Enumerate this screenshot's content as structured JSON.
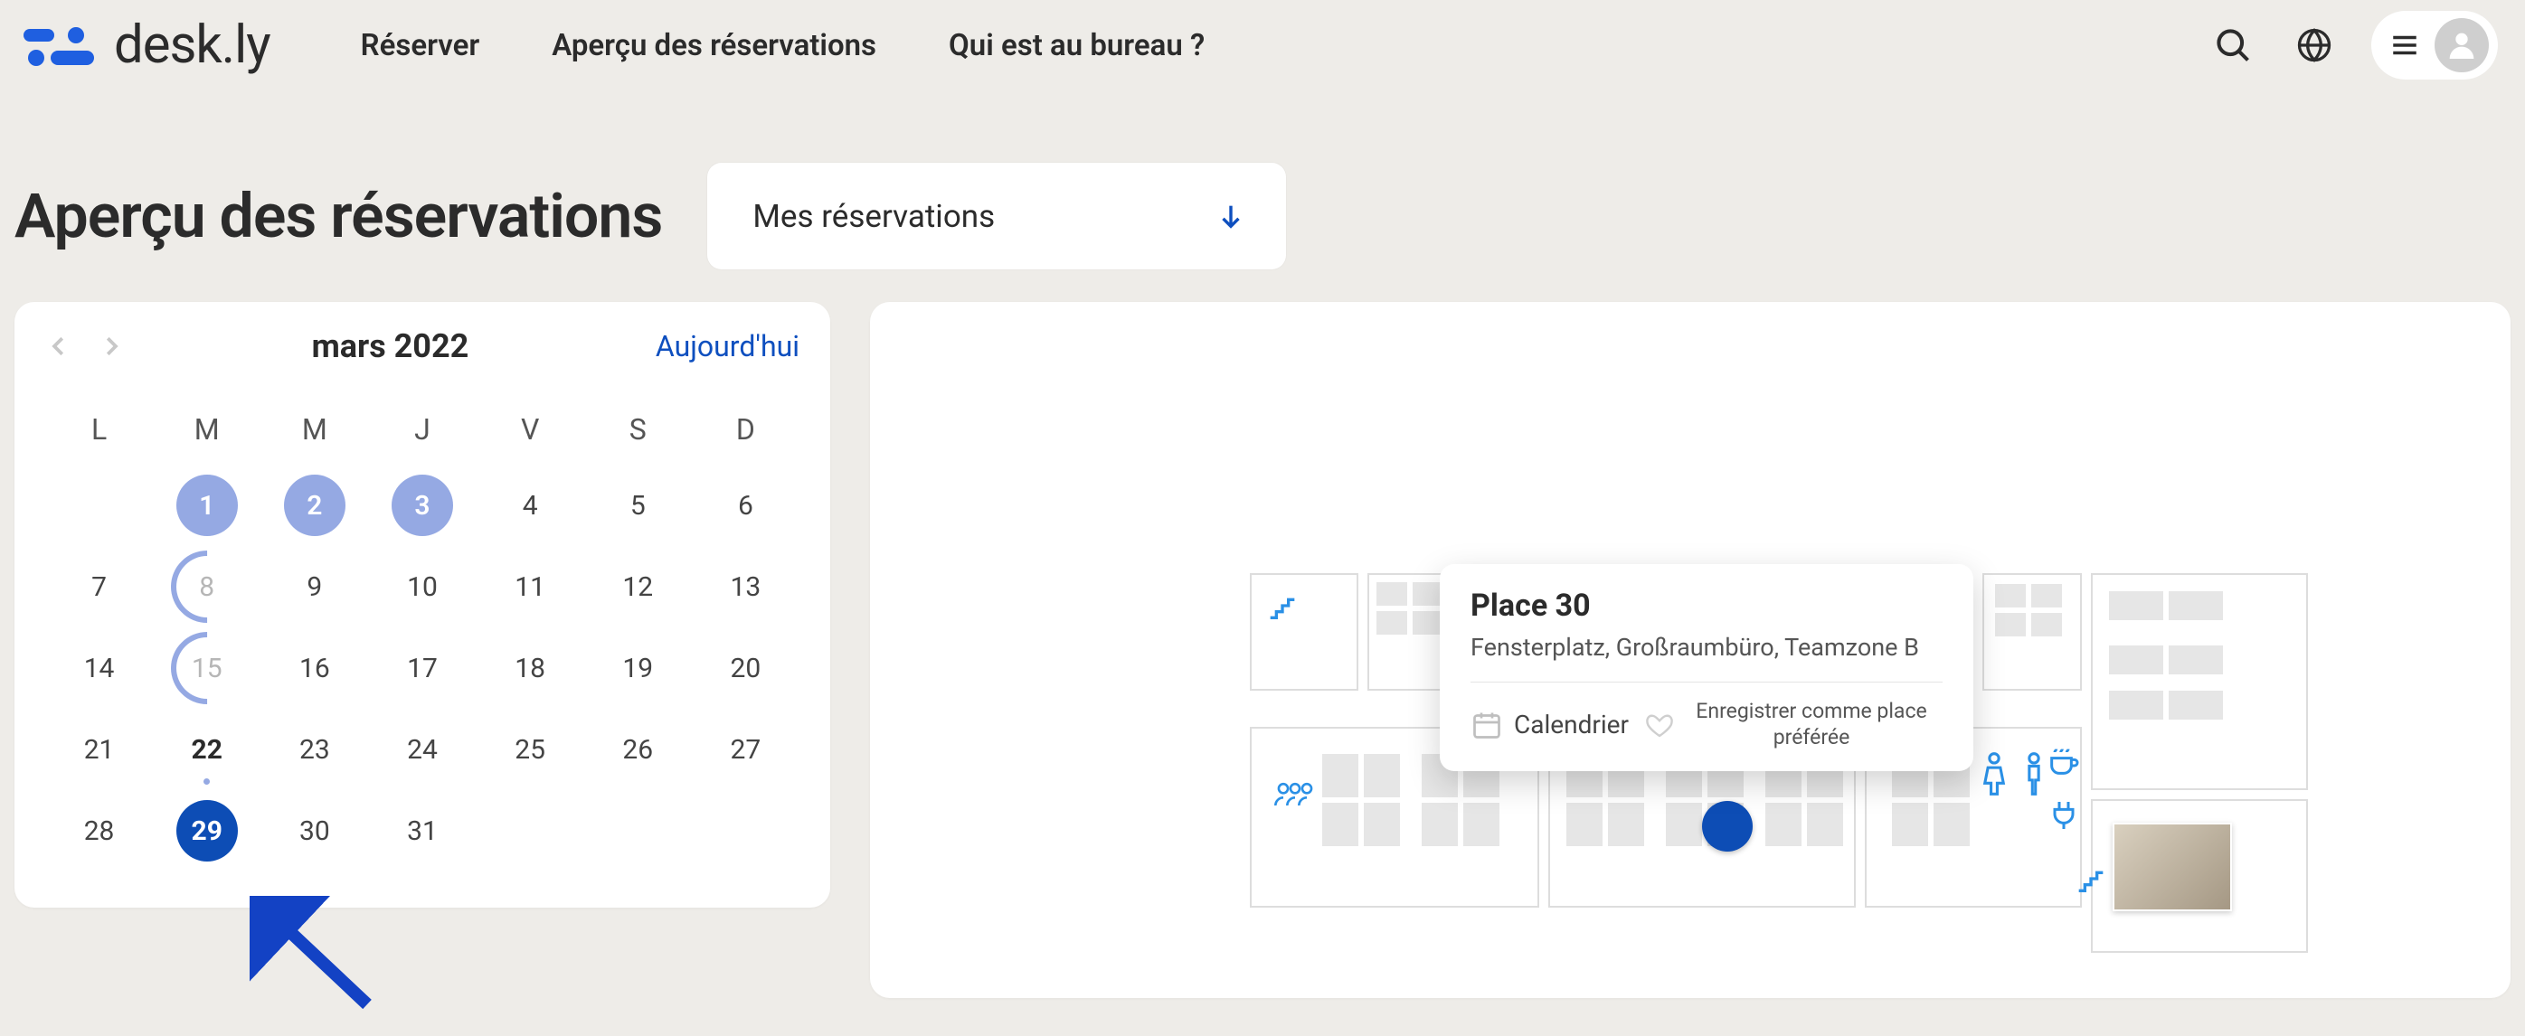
{
  "brand": {
    "name": "desk.ly"
  },
  "nav": {
    "reserve": "Réserver",
    "overview": "Aperçu des réservations",
    "whos_in": "Qui est au bureau ?"
  },
  "header_icons": {
    "search": "search-icon",
    "language": "globe-icon",
    "menu": "menu-icon",
    "avatar": "user-avatar"
  },
  "page": {
    "title": "Aperçu des réservations"
  },
  "filter": {
    "selected": "Mes réservations"
  },
  "calendar": {
    "month_label": "mars 2022",
    "today_label": "Aujourd'hui",
    "dows": [
      "L",
      "M",
      "M",
      "J",
      "V",
      "S",
      "D"
    ],
    "weeks": [
      [
        {
          "n": "",
          "state": "blank"
        },
        {
          "n": "1",
          "state": "booked"
        },
        {
          "n": "2",
          "state": "booked"
        },
        {
          "n": "3",
          "state": "booked"
        },
        {
          "n": "4",
          "state": ""
        },
        {
          "n": "5",
          "state": ""
        },
        {
          "n": "6",
          "state": ""
        }
      ],
      [
        {
          "n": "7",
          "state": ""
        },
        {
          "n": "8",
          "state": "partial"
        },
        {
          "n": "9",
          "state": ""
        },
        {
          "n": "10",
          "state": ""
        },
        {
          "n": "11",
          "state": ""
        },
        {
          "n": "12",
          "state": ""
        },
        {
          "n": "13",
          "state": ""
        }
      ],
      [
        {
          "n": "14",
          "state": ""
        },
        {
          "n": "15",
          "state": "partial"
        },
        {
          "n": "16",
          "state": ""
        },
        {
          "n": "17",
          "state": ""
        },
        {
          "n": "18",
          "state": ""
        },
        {
          "n": "19",
          "state": ""
        },
        {
          "n": "20",
          "state": ""
        }
      ],
      [
        {
          "n": "21",
          "state": ""
        },
        {
          "n": "22",
          "state": "bold"
        },
        {
          "n": "23",
          "state": ""
        },
        {
          "n": "24",
          "state": ""
        },
        {
          "n": "25",
          "state": ""
        },
        {
          "n": "26",
          "state": ""
        },
        {
          "n": "27",
          "state": ""
        }
      ],
      [
        {
          "n": "28",
          "state": ""
        },
        {
          "n": "29",
          "state": "selected"
        },
        {
          "n": "30",
          "state": ""
        },
        {
          "n": "31",
          "state": ""
        },
        {
          "n": "",
          "state": "blank"
        },
        {
          "n": "",
          "state": "blank"
        },
        {
          "n": "",
          "state": "blank"
        }
      ]
    ]
  },
  "popover": {
    "title": "Place 30",
    "subtitle": "Fensterplatz, Großraumbüro, Teamzone B",
    "calendar_label": "Calendrier",
    "favorite_label": "Enregistrer comme place préférée"
  },
  "colors": {
    "brand_blue": "#0d4db5",
    "accent_blue": "#2a90e6",
    "booked_lavender": "#95a9e3"
  }
}
